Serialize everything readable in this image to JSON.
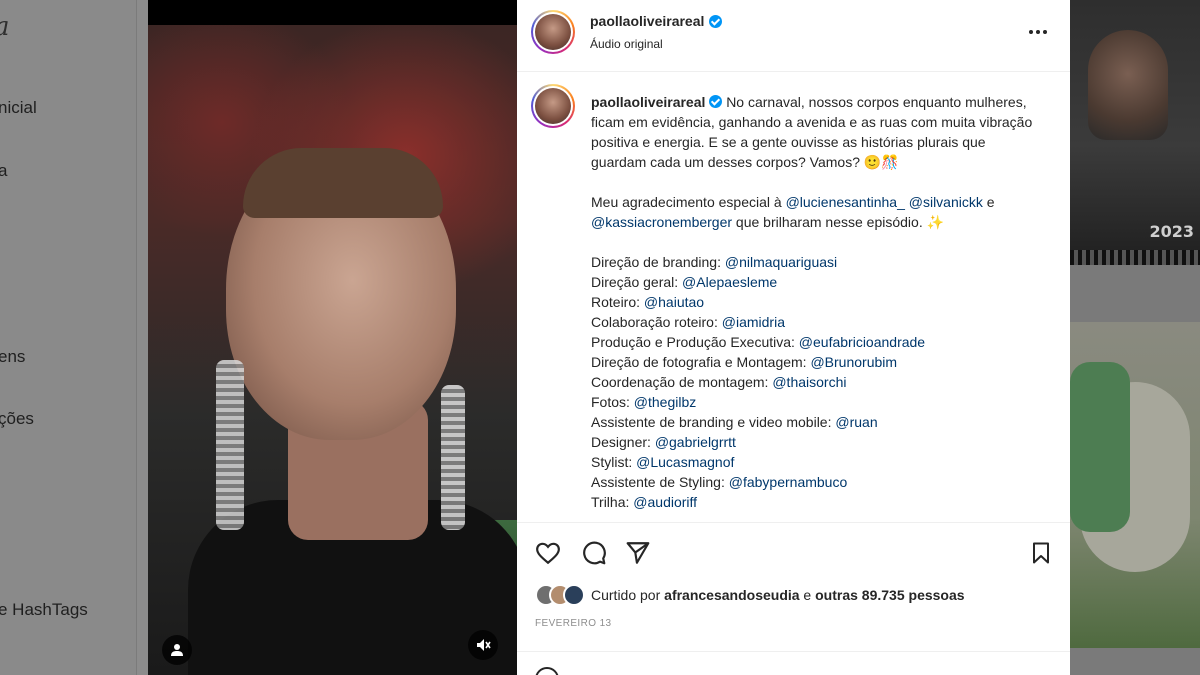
{
  "sidebar": {
    "logo": "a",
    "items": [
      {
        "label": "nicial"
      },
      {
        "label": "a"
      },
      {
        "label": "ens"
      },
      {
        "label": "ções"
      },
      {
        "label": "e HashTags"
      }
    ]
  },
  "background_tile": {
    "year": "2023"
  },
  "post": {
    "username": "paollaoliveirareal",
    "audio": "Áudio original",
    "more_icon": "more-horizontal-icon",
    "caption": {
      "username": "paollaoliveirareal",
      "intro": "No carnaval, nossos corpos enquanto mulheres, ficam em evidência, ganhando a avenida e as ruas com muita vibração positiva e energia. E se a gente ouvisse as histórias plurais que guardam cada um desses corpos? Vamos?",
      "emojis": "🙂🎊",
      "thanks_prefix": "Meu agradecimento especial à ",
      "thanks_mentions": [
        "@lucienesantinha_",
        "@silvanickk",
        "@kassiacronemberger"
      ],
      "thanks_suffix": " que brilharam nesse episódio. ✨",
      "thanks_and": " e",
      "credits": [
        {
          "role": "Direção de branding: ",
          "mention": "@nilmaquariguasi"
        },
        {
          "role": "Direção geral: ",
          "mention": "@Alepaesleme"
        },
        {
          "role": "Roteiro: ",
          "mention": "@haiutao"
        },
        {
          "role": "Colaboração roteiro: ",
          "mention": "@iamidria"
        },
        {
          "role": "Produção e Produção Executiva: ",
          "mention": "@eufabricioandrade"
        },
        {
          "role": "Direção de fotografia e Montagem: ",
          "mention": "@Brunorubim"
        },
        {
          "role": "Coordenação de montagem: ",
          "mention": "@thaisorchi"
        },
        {
          "role": "Fotos: ",
          "mention": "@thegilbz"
        },
        {
          "role": "Assistente de branding e video mobile: ",
          "mention": "@ruan"
        },
        {
          "role": "Designer: ",
          "mention": "@gabrielgrrtt"
        },
        {
          "role": "Stylist: ",
          "mention": "@Lucasmagnof"
        },
        {
          "role": "Assistente de Styling: ",
          "mention": "@fabypernambuco"
        },
        {
          "role": "Trilha: ",
          "mention": "@audioriff"
        }
      ]
    },
    "actions": {
      "like_icon": "heart-icon",
      "comment_icon": "comment-icon",
      "share_icon": "send-icon",
      "save_icon": "bookmark-icon"
    },
    "likes": {
      "prefix": "Curtido por ",
      "user": "afrancesandoseudia",
      "middle": " e ",
      "others": "outras 89.735 pessoas"
    },
    "date": "FEVEREIRO 13"
  },
  "colors": {
    "mention": "#00376b",
    "verified": "#0095f6",
    "text": "#262626",
    "muted": "#8e8e8e"
  }
}
